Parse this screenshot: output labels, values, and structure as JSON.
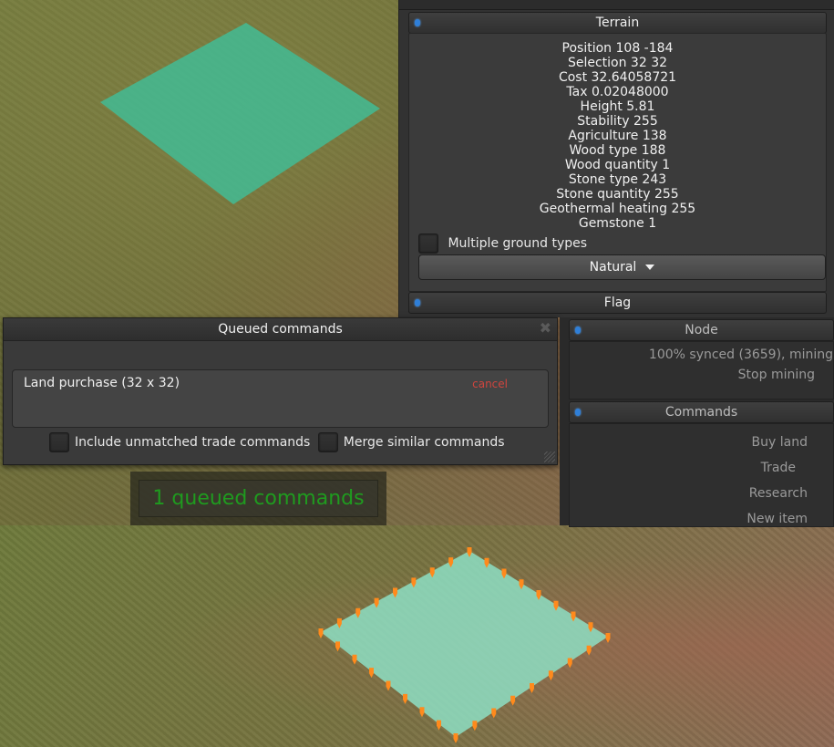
{
  "terrain": {
    "title": "Terrain",
    "stats": [
      "Position 108 -184",
      "Selection 32 32",
      "Cost 32.64058721",
      "Tax 0.02048000",
      "Height 5.81",
      "Stability 255",
      "Agriculture 138",
      "Wood type 188",
      "Wood quantity 1",
      "Stone type 243",
      "Stone quantity 255",
      "Geothermal heating 255",
      "Gemstone 1"
    ],
    "multiple_ground_types_label": "Multiple ground types",
    "ground_type_selected": "Natural"
  },
  "flag": {
    "title": "Flag"
  },
  "queued_window": {
    "title": "Queued commands",
    "close_glyph": "✖",
    "item": {
      "label": "Land purchase (32 x 32)",
      "cancel_label": "cancel"
    },
    "include_unmatched_label": "Include unmatched trade commands",
    "merge_similar_label": "Merge similar commands"
  },
  "queued_counter": "1 queued commands",
  "node": {
    "title": "Node",
    "status": "100% synced (3659), mining",
    "stop_mining_label": "Stop mining"
  },
  "commands": {
    "title": "Commands",
    "items": [
      "Buy land",
      "Trade",
      "Research",
      "New item"
    ]
  },
  "colors": {
    "selection_fill": "#3fbf9a",
    "selection_fill_light": "#7fdcc0",
    "marker": "#ff8a1c",
    "cancel": "#d0453e",
    "counter_text": "#1f9b1f",
    "header_dot": "#2f7fd8"
  }
}
